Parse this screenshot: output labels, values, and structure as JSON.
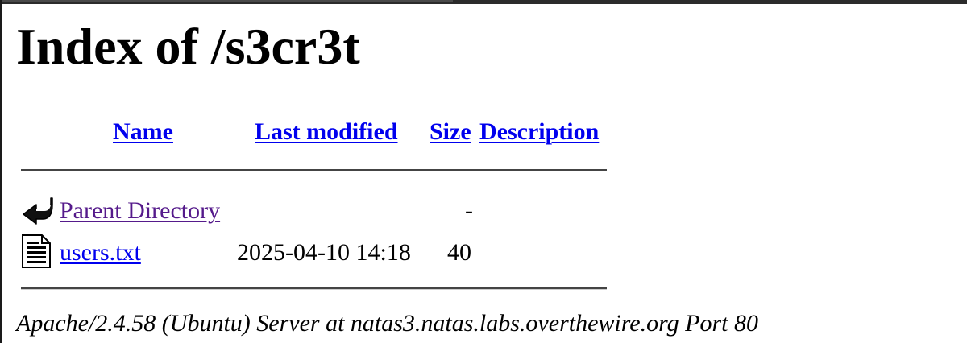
{
  "page": {
    "title": "Index of /s3cr3t"
  },
  "table": {
    "headers": {
      "name": "Name",
      "last_modified": "Last modified",
      "size": "Size",
      "description": "Description"
    },
    "rows": [
      {
        "icon": "back-arrow-icon",
        "name": "Parent Directory",
        "last_modified": "",
        "size": "-",
        "description": ""
      },
      {
        "icon": "text-file-icon",
        "name": "users.txt",
        "last_modified": "2025-04-10 14:18",
        "size": "40",
        "description": ""
      }
    ]
  },
  "footer": {
    "signature": "Apache/2.4.58 (Ubuntu) Server at natas3.natas.labs.overthewire.org Port 80"
  },
  "colors": {
    "link": "#0000ee",
    "visited_link": "#551a8b",
    "text": "#000000",
    "background": "#ffffff"
  }
}
